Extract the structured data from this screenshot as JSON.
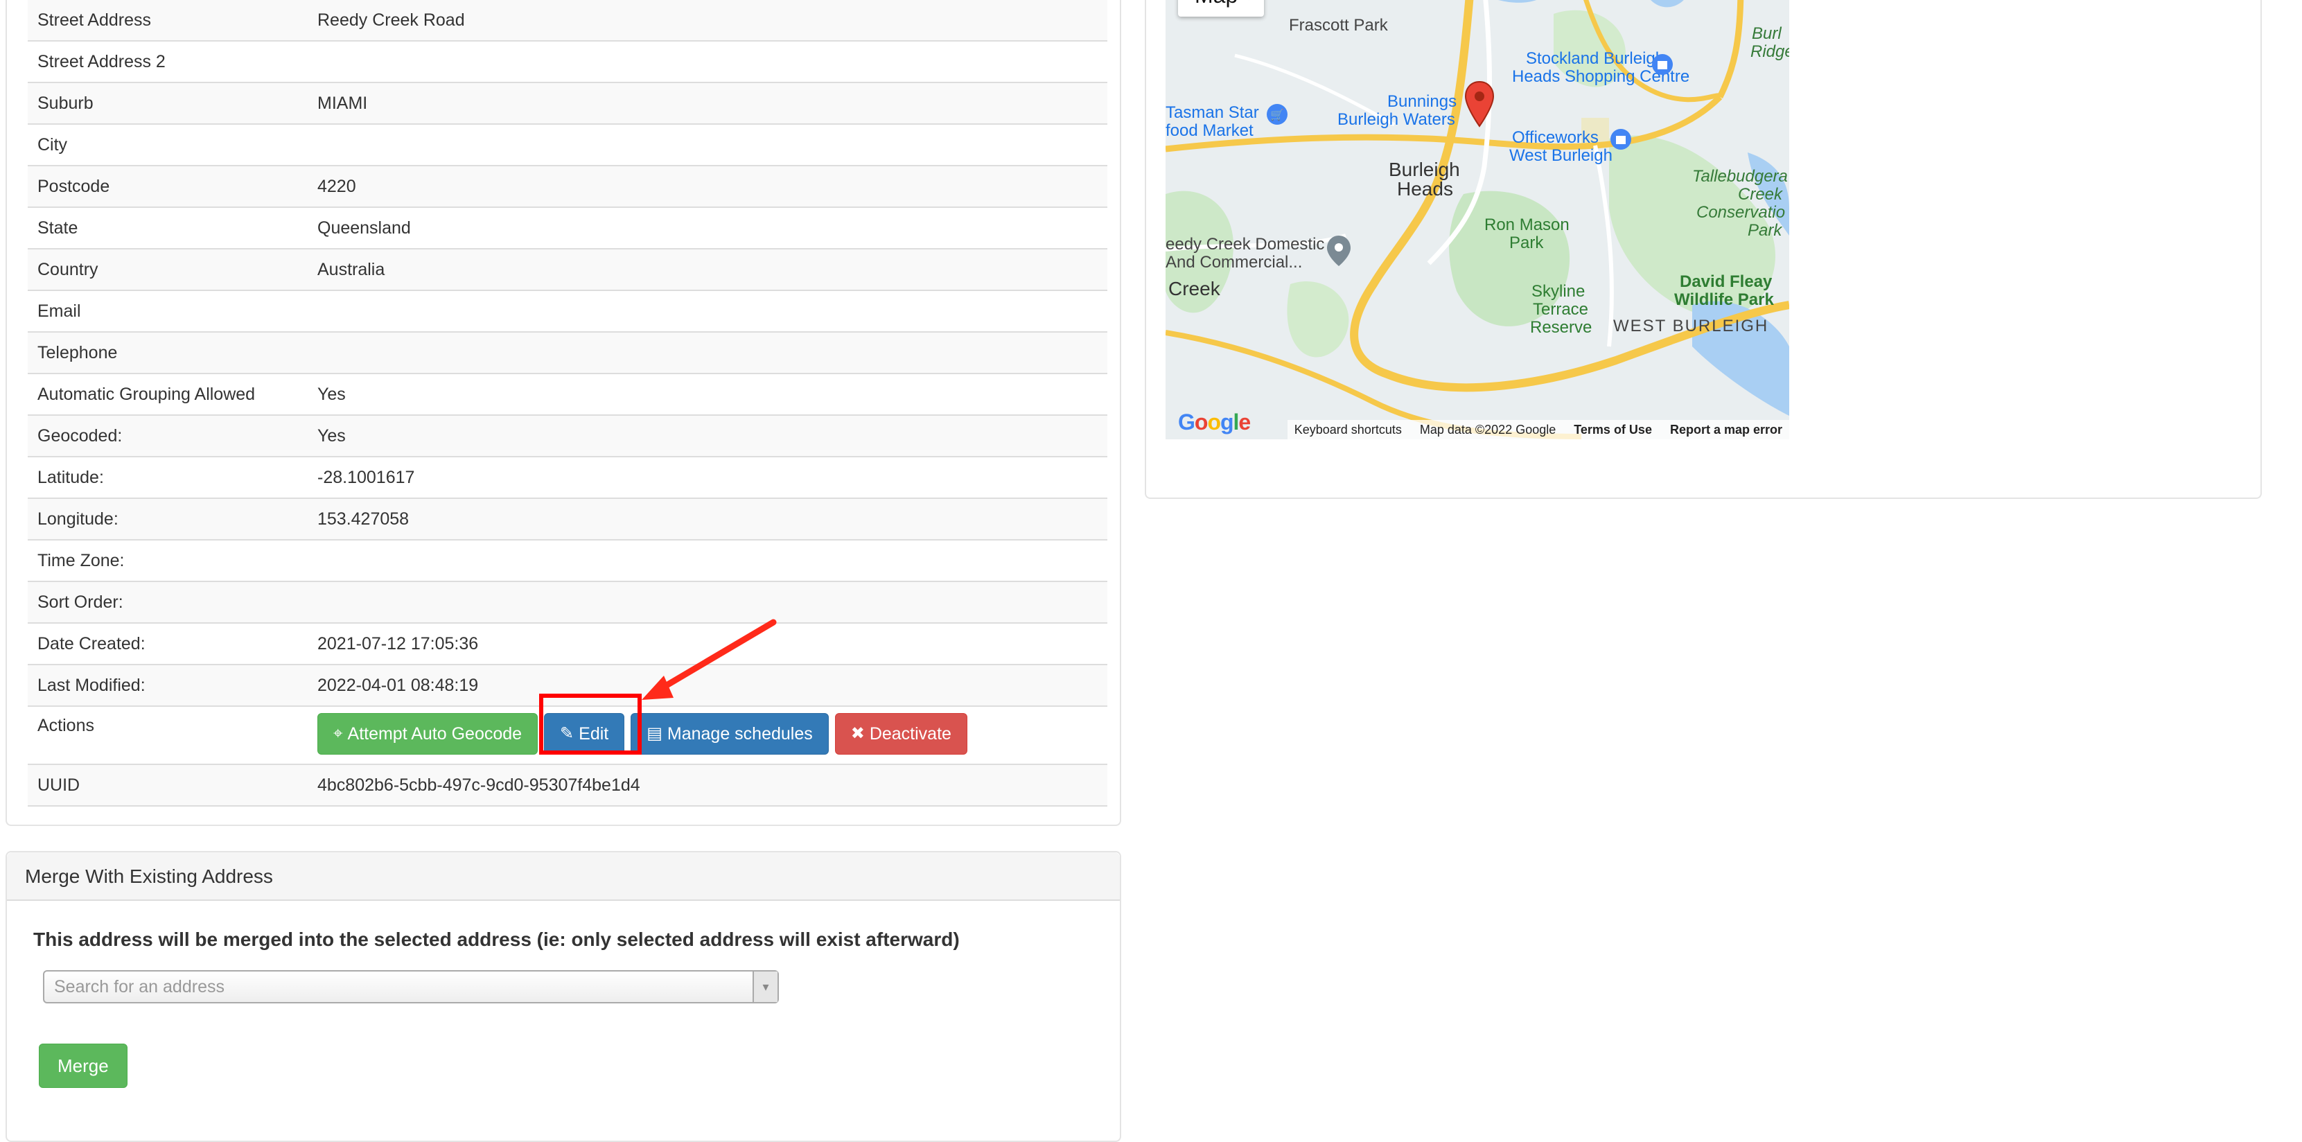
{
  "details": {
    "rows": [
      {
        "label": "Street Address",
        "value": "Reedy Creek Road"
      },
      {
        "label": "Street Address 2",
        "value": ""
      },
      {
        "label": "Suburb",
        "value": "MIAMI"
      },
      {
        "label": "City",
        "value": ""
      },
      {
        "label": "Postcode",
        "value": "4220"
      },
      {
        "label": "State",
        "value": "Queensland"
      },
      {
        "label": "Country",
        "value": "Australia"
      },
      {
        "label": "Email",
        "value": ""
      },
      {
        "label": "Telephone",
        "value": ""
      },
      {
        "label": "Automatic Grouping Allowed",
        "value": "Yes"
      },
      {
        "label": "Geocoded:",
        "value": "Yes"
      },
      {
        "label": "Latitude:",
        "value": "-28.1001617"
      },
      {
        "label": "Longitude:",
        "value": "153.427058"
      },
      {
        "label": "Time Zone:",
        "value": ""
      },
      {
        "label": "Sort Order:",
        "value": ""
      },
      {
        "label": "Date Created:",
        "value": "2021-07-12 17:05:36"
      },
      {
        "label": "Last Modified:",
        "value": "2022-04-01 08:48:19"
      }
    ],
    "actions_label": "Actions",
    "buttons": {
      "geocode": "Attempt Auto Geocode",
      "edit": "Edit",
      "schedules": "Manage schedules",
      "deactivate": "Deactivate"
    },
    "uuid_label": "UUID",
    "uuid_value": "4bc802b6-5cbb-497c-9cd0-95307f4be1d4"
  },
  "merge": {
    "heading": "Merge With Existing Address",
    "description": "This address will be merged into the selected address (ie: only selected address will exist afterward)",
    "search_placeholder": "Search for an address",
    "merge_button": "Merge"
  },
  "map": {
    "type_button": "Map",
    "labels": {
      "frascott": "Frascott Park",
      "stockland": "Stockland Burleigh",
      "stockland2": "Heads Shopping Centre",
      "bunnings": "Bunnings",
      "bunnings2": "Burleigh Waters",
      "tasman": "Tasman Star",
      "tasman2": "food Market",
      "officeworks": "Officeworks",
      "officeworks2": "West Burleigh",
      "burleigh": "Burleigh",
      "burleigh2": "Heads",
      "ronmason": "Ron Mason",
      "ronmason2": "Park",
      "reedy": "eedy Creek Domestic",
      "reedy2": "And Commercial...",
      "creek": "Creek",
      "skyline": "Skyline",
      "skyline2": "Terrace",
      "skyline3": "Reserve",
      "westburleigh": "WEST BURLEIGH",
      "davidfleay": "David Fleay",
      "davidfleay2": "Wildlife Park",
      "tallebudgera": "Tallebudgera",
      "tallebudgera2": "Creek",
      "tallebudgera3": "Conservatio",
      "tallebudgera4": "Park",
      "burl": "Burl",
      "ridge": "Ridge"
    },
    "footer": {
      "shortcuts": "Keyboard shortcuts",
      "mapdata": "Map data ©2022 Google",
      "terms": "Terms of Use",
      "report": "Report a map error"
    },
    "logo": "Google"
  },
  "colors": {
    "success": "#5cb85c",
    "primary": "#337ab7",
    "danger": "#d9534f",
    "highlight": "#ff0000"
  }
}
